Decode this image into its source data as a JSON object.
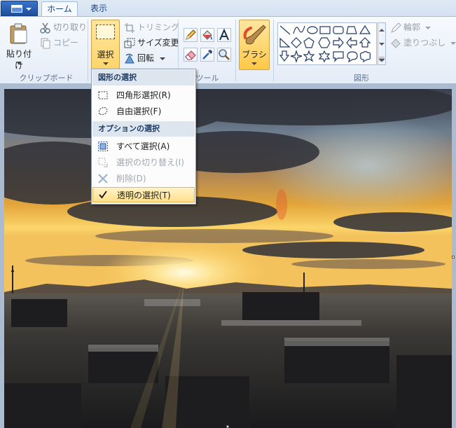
{
  "tabs": {
    "home": "ホーム",
    "view": "表示"
  },
  "clipboard": {
    "paste_label": "貼り付け",
    "cut_label": "切り取り",
    "copy_label": "コピー",
    "group_label": "クリップボード"
  },
  "image": {
    "select_label": "選択",
    "crop_label": "トリミング",
    "resize_label": "サイズ変更",
    "rotate_label": "回転"
  },
  "tools": {
    "group_label": "ツール"
  },
  "brush": {
    "label": "ブラシ"
  },
  "shapes": {
    "outline_label": "輪郭",
    "fill_label": "塗りつぶし",
    "group_label": "図形"
  },
  "select_menu": {
    "shape_header": "図形の選択",
    "rect_select": "四角形選択(R)",
    "free_select": "自由選択(F)",
    "option_header": "オプションの選択",
    "select_all": "すべて選択(A)",
    "invert_select": "選択の切り替え(I)",
    "delete": "削除(D)",
    "transparent_select": "透明の選択(T)"
  },
  "icons": [
    "file-menu-icon",
    "paste-icon",
    "scissors-icon",
    "copy-icon",
    "select-rect-icon",
    "crop-icon",
    "resize-icon",
    "rotate-icon",
    "pencil-icon",
    "fill-icon",
    "text-icon",
    "eraser-icon",
    "color-picker-icon",
    "magnifier-icon",
    "brush-icon",
    "outline-icon",
    "fill-bucket-icon",
    "checkmark-icon"
  ]
}
